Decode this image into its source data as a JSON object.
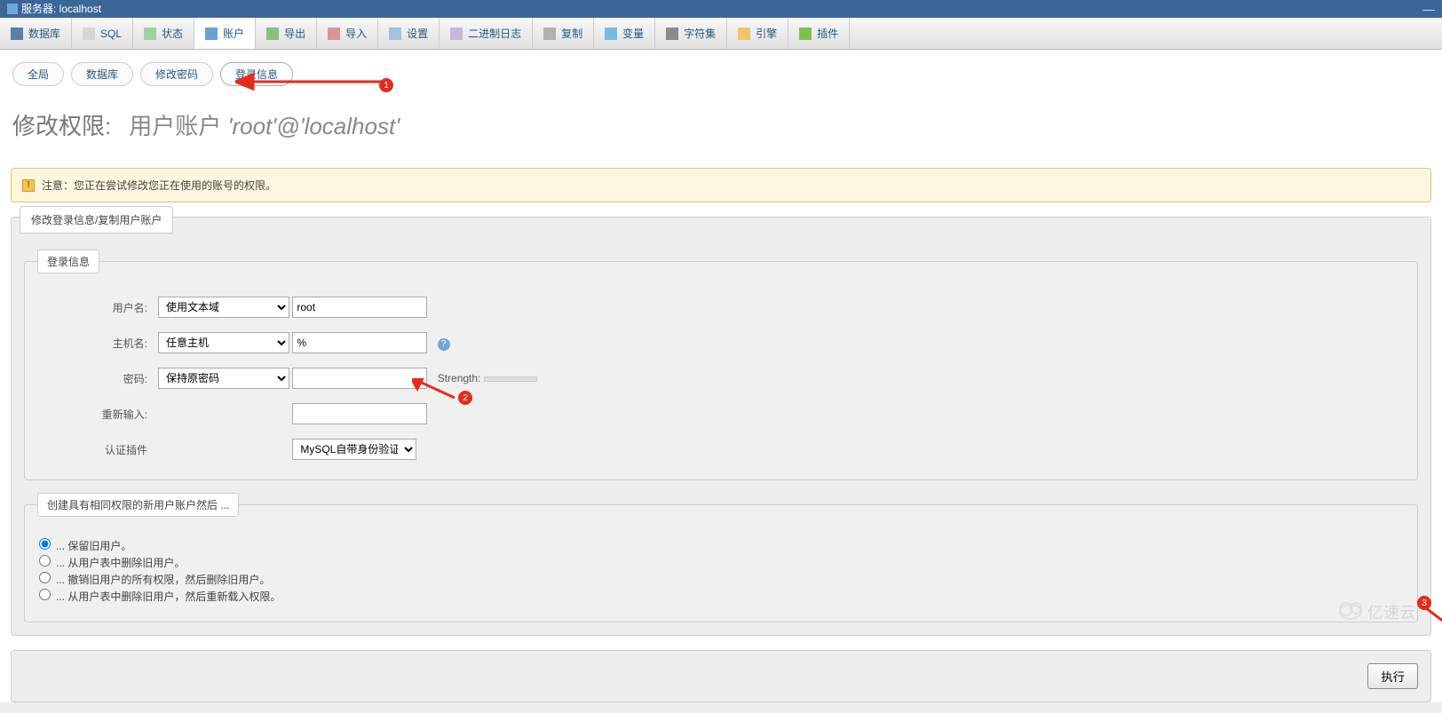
{
  "titlebar": {
    "server_label": "服务器: localhost"
  },
  "tabs": [
    {
      "key": "databases",
      "label": "数据库",
      "icon": "icon-db"
    },
    {
      "key": "sql",
      "label": "SQL",
      "icon": "icon-sql"
    },
    {
      "key": "status",
      "label": "状态",
      "icon": "icon-status"
    },
    {
      "key": "accounts",
      "label": "账户",
      "icon": "icon-accounts",
      "active": true
    },
    {
      "key": "export",
      "label": "导出",
      "icon": "icon-export"
    },
    {
      "key": "import",
      "label": "导入",
      "icon": "icon-import"
    },
    {
      "key": "settings",
      "label": "设置",
      "icon": "icon-settings"
    },
    {
      "key": "binlog",
      "label": "二进制日志",
      "icon": "icon-binlog"
    },
    {
      "key": "replication",
      "label": "复制",
      "icon": "icon-replication"
    },
    {
      "key": "variables",
      "label": "变量",
      "icon": "icon-variables"
    },
    {
      "key": "charsets",
      "label": "字符集",
      "icon": "icon-charsets"
    },
    {
      "key": "engines",
      "label": "引擎",
      "icon": "icon-engines"
    },
    {
      "key": "plugins",
      "label": "插件",
      "icon": "icon-plugins"
    }
  ],
  "subtabs": {
    "global": "全局",
    "database": "数据库",
    "change_password": "修改密码",
    "login_info": "登录信息"
  },
  "page_title": {
    "prefix": "修改权限:",
    "subtitle": "用户账户",
    "account": "'root'@'localhost'"
  },
  "notice": "注意：您正在尝试修改您正在使用的账号的权限。",
  "panel_header": "修改登录信息/复制用户账户",
  "fieldset_login": "登录信息",
  "form": {
    "username_label": "用户名:",
    "username_select": "使用文本域",
    "username_value": "root",
    "host_label": "主机名:",
    "host_select": "任意主机",
    "host_value": "%",
    "password_label": "密码:",
    "password_select": "保持原密码",
    "password_value": "",
    "strength_label": "Strength:",
    "retype_label": "重新输入:",
    "retype_value": "",
    "auth_label": "认证插件",
    "auth_select": "MySQL自带身份验证"
  },
  "fieldset_create": "创建具有相同权限的新用户账户然后 ...",
  "radios": {
    "r1": "... 保留旧用户。",
    "r2": "... 从用户表中删除旧用户。",
    "r3": "... 撤销旧用户的所有权限，然后删除旧用户。",
    "r4": "... 从用户表中删除旧用户，然后重新载入权限。"
  },
  "go_button": "执行",
  "annotations": {
    "a1": "1",
    "a2": "2",
    "a3": "3"
  },
  "watermark": "亿速云"
}
